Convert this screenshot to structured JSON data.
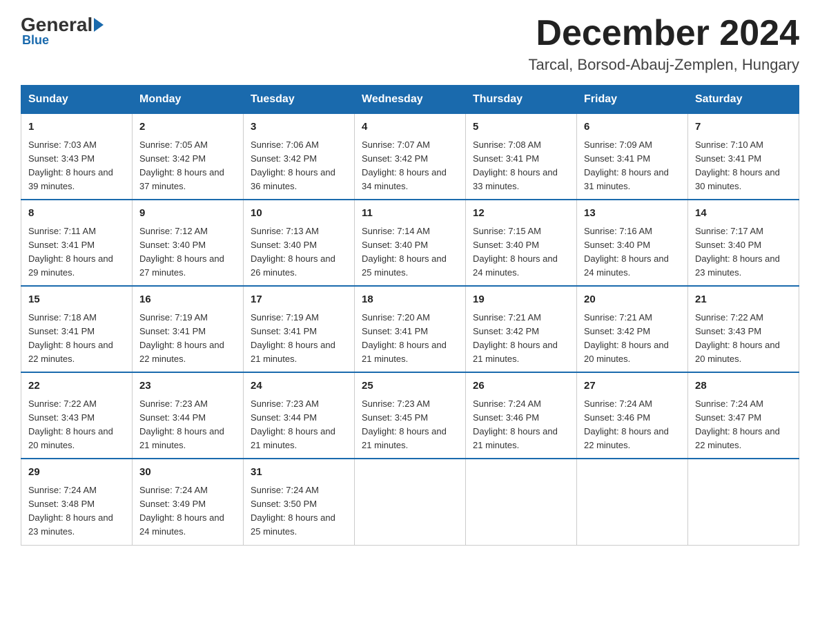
{
  "logo": {
    "general": "General",
    "blue": "Blue",
    "subtitle": "Blue"
  },
  "title": {
    "month_year": "December 2024",
    "location": "Tarcal, Borsod-Abauj-Zemplen, Hungary"
  },
  "days_of_week": [
    "Sunday",
    "Monday",
    "Tuesday",
    "Wednesday",
    "Thursday",
    "Friday",
    "Saturday"
  ],
  "weeks": [
    [
      {
        "day": "1",
        "sunrise": "7:03 AM",
        "sunset": "3:43 PM",
        "daylight": "8 hours and 39 minutes."
      },
      {
        "day": "2",
        "sunrise": "7:05 AM",
        "sunset": "3:42 PM",
        "daylight": "8 hours and 37 minutes."
      },
      {
        "day": "3",
        "sunrise": "7:06 AM",
        "sunset": "3:42 PM",
        "daylight": "8 hours and 36 minutes."
      },
      {
        "day": "4",
        "sunrise": "7:07 AM",
        "sunset": "3:42 PM",
        "daylight": "8 hours and 34 minutes."
      },
      {
        "day": "5",
        "sunrise": "7:08 AM",
        "sunset": "3:41 PM",
        "daylight": "8 hours and 33 minutes."
      },
      {
        "day": "6",
        "sunrise": "7:09 AM",
        "sunset": "3:41 PM",
        "daylight": "8 hours and 31 minutes."
      },
      {
        "day": "7",
        "sunrise": "7:10 AM",
        "sunset": "3:41 PM",
        "daylight": "8 hours and 30 minutes."
      }
    ],
    [
      {
        "day": "8",
        "sunrise": "7:11 AM",
        "sunset": "3:41 PM",
        "daylight": "8 hours and 29 minutes."
      },
      {
        "day": "9",
        "sunrise": "7:12 AM",
        "sunset": "3:40 PM",
        "daylight": "8 hours and 27 minutes."
      },
      {
        "day": "10",
        "sunrise": "7:13 AM",
        "sunset": "3:40 PM",
        "daylight": "8 hours and 26 minutes."
      },
      {
        "day": "11",
        "sunrise": "7:14 AM",
        "sunset": "3:40 PM",
        "daylight": "8 hours and 25 minutes."
      },
      {
        "day": "12",
        "sunrise": "7:15 AM",
        "sunset": "3:40 PM",
        "daylight": "8 hours and 24 minutes."
      },
      {
        "day": "13",
        "sunrise": "7:16 AM",
        "sunset": "3:40 PM",
        "daylight": "8 hours and 24 minutes."
      },
      {
        "day": "14",
        "sunrise": "7:17 AM",
        "sunset": "3:40 PM",
        "daylight": "8 hours and 23 minutes."
      }
    ],
    [
      {
        "day": "15",
        "sunrise": "7:18 AM",
        "sunset": "3:41 PM",
        "daylight": "8 hours and 22 minutes."
      },
      {
        "day": "16",
        "sunrise": "7:19 AM",
        "sunset": "3:41 PM",
        "daylight": "8 hours and 22 minutes."
      },
      {
        "day": "17",
        "sunrise": "7:19 AM",
        "sunset": "3:41 PM",
        "daylight": "8 hours and 21 minutes."
      },
      {
        "day": "18",
        "sunrise": "7:20 AM",
        "sunset": "3:41 PM",
        "daylight": "8 hours and 21 minutes."
      },
      {
        "day": "19",
        "sunrise": "7:21 AM",
        "sunset": "3:42 PM",
        "daylight": "8 hours and 21 minutes."
      },
      {
        "day": "20",
        "sunrise": "7:21 AM",
        "sunset": "3:42 PM",
        "daylight": "8 hours and 20 minutes."
      },
      {
        "day": "21",
        "sunrise": "7:22 AM",
        "sunset": "3:43 PM",
        "daylight": "8 hours and 20 minutes."
      }
    ],
    [
      {
        "day": "22",
        "sunrise": "7:22 AM",
        "sunset": "3:43 PM",
        "daylight": "8 hours and 20 minutes."
      },
      {
        "day": "23",
        "sunrise": "7:23 AM",
        "sunset": "3:44 PM",
        "daylight": "8 hours and 21 minutes."
      },
      {
        "day": "24",
        "sunrise": "7:23 AM",
        "sunset": "3:44 PM",
        "daylight": "8 hours and 21 minutes."
      },
      {
        "day": "25",
        "sunrise": "7:23 AM",
        "sunset": "3:45 PM",
        "daylight": "8 hours and 21 minutes."
      },
      {
        "day": "26",
        "sunrise": "7:24 AM",
        "sunset": "3:46 PM",
        "daylight": "8 hours and 21 minutes."
      },
      {
        "day": "27",
        "sunrise": "7:24 AM",
        "sunset": "3:46 PM",
        "daylight": "8 hours and 22 minutes."
      },
      {
        "day": "28",
        "sunrise": "7:24 AM",
        "sunset": "3:47 PM",
        "daylight": "8 hours and 22 minutes."
      }
    ],
    [
      {
        "day": "29",
        "sunrise": "7:24 AM",
        "sunset": "3:48 PM",
        "daylight": "8 hours and 23 minutes."
      },
      {
        "day": "30",
        "sunrise": "7:24 AM",
        "sunset": "3:49 PM",
        "daylight": "8 hours and 24 minutes."
      },
      {
        "day": "31",
        "sunrise": "7:24 AM",
        "sunset": "3:50 PM",
        "daylight": "8 hours and 25 minutes."
      },
      null,
      null,
      null,
      null
    ]
  ],
  "labels": {
    "sunrise_prefix": "Sunrise: ",
    "sunset_prefix": "Sunset: ",
    "daylight_prefix": "Daylight: "
  }
}
